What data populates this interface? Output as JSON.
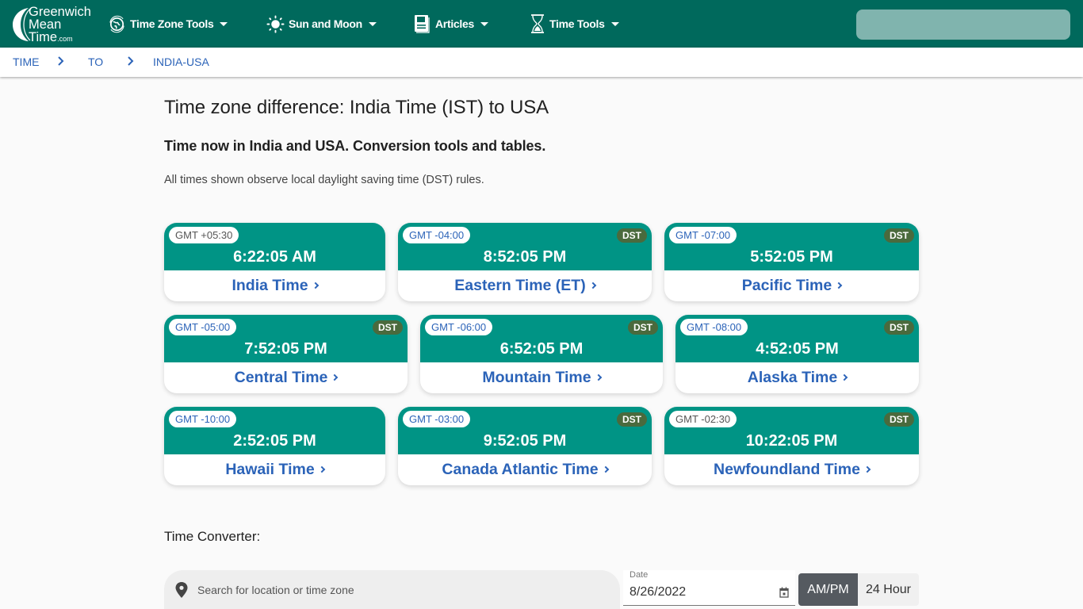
{
  "header": {
    "logo": {
      "line1": "Greenwich",
      "line2": "Mean",
      "line3": "Time",
      "suffix": ".com"
    },
    "nav": [
      {
        "label": "Time Zone Tools",
        "icon": "globe-icon"
      },
      {
        "label": "Sun and Moon",
        "icon": "sun-icon"
      },
      {
        "label": "Articles",
        "icon": "newspaper-icon"
      },
      {
        "label": "Time Tools",
        "icon": "hourglass-icon"
      }
    ],
    "search_value": ""
  },
  "breadcrumb": [
    {
      "label": "TIME"
    },
    {
      "label": "TO"
    },
    {
      "label": "INDIA-USA"
    }
  ],
  "page": {
    "title": "Time zone difference: India Time (IST) to USA",
    "subtitle": "Time now in India and USA. Conversion tools and tables.",
    "note": "All times shown observe local daylight saving time (DST) rules."
  },
  "zones": [
    {
      "gmt": "GMT +05:30",
      "time": "6:22:05 AM",
      "name": "India Time",
      "dst": ""
    },
    {
      "gmt": "GMT -04:00",
      "time": "8:52:05 PM",
      "name": "Eastern Time (ET)",
      "dst": "DST"
    },
    {
      "gmt": "GMT -07:00",
      "time": "5:52:05 PM",
      "name": "Pacific Time",
      "dst": "DST"
    },
    {
      "gmt": "GMT -05:00",
      "time": "7:52:05 PM",
      "name": "Central Time",
      "dst": "DST"
    },
    {
      "gmt": "GMT -06:00",
      "time": "6:52:05 PM",
      "name": "Mountain Time",
      "dst": "DST"
    },
    {
      "gmt": "GMT -08:00",
      "time": "4:52:05 PM",
      "name": "Alaska Time",
      "dst": "DST"
    },
    {
      "gmt": "GMT -10:00",
      "time": "2:52:05 PM",
      "name": "Hawaii Time",
      "dst": ""
    },
    {
      "gmt": "GMT -03:00",
      "time": "9:52:05 PM",
      "name": "Canada Atlantic Time",
      "dst": "DST"
    },
    {
      "gmt": "GMT -02:30",
      "time": "10:22:05 PM",
      "name": "Newfoundland Time",
      "dst": "DST"
    }
  ],
  "converter": {
    "label": "Time Converter:",
    "search_placeholder": "Search for location or time zone",
    "date_label": "Date",
    "date_value": "8/26/2022",
    "format_options": [
      "AM/PM",
      "24 Hour"
    ],
    "format_selected": "AM/PM"
  },
  "colors": {
    "header_bg": "#00695c",
    "card_head": "#009485",
    "link": "#2b63b8",
    "dst_badge": "#4a6a3d"
  }
}
